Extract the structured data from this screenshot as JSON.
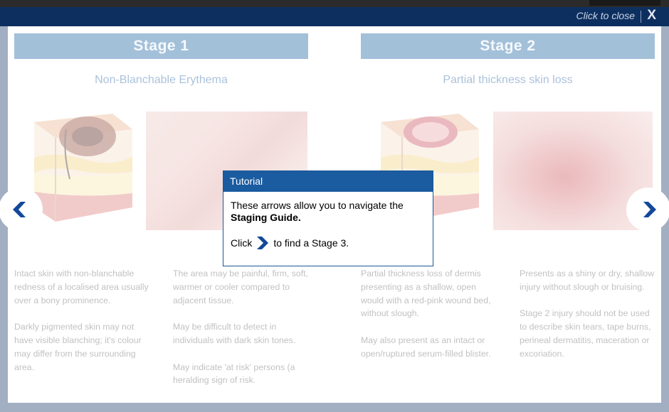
{
  "header": {
    "close_text": "Click to close",
    "close_icon_glyph": "X"
  },
  "stages": [
    {
      "title": "Stage 1",
      "subtitle": "Non-Blanchable Erythema",
      "col1": [
        "Intact skin with non-blanchable redness of a localised area usually over a bony prominence.",
        "Darkly pigmented skin may not have visible blanching; it's colour may differ from the surrounding area."
      ],
      "col2": [
        "The area may be painful, firm, soft, warmer or cooler compared to adjacent tissue.",
        "May be difficult to detect in individuals with dark skin tones.",
        "May indicate 'at risk' persons (a heralding sign of risk."
      ]
    },
    {
      "title": "Stage 2",
      "subtitle": "Partial thickness skin loss",
      "col1": [
        "Partial thickness loss of dermis presenting as a shallow, open would with a red-pink wound bed, without slough.",
        "May also present as an intact or open/ruptured serum-filled blister."
      ],
      "col2": [
        "Presents as a shiny or dry, shallow injury without slough or bruising.",
        "Stage 2 injury should not be used to describe skin tears, tape burns, perineal dermatitis, maceration or excoriation."
      ]
    }
  ],
  "nav": {
    "prev_icon": "chevron-left-icon",
    "next_icon": "chevron-right-icon"
  },
  "tutorial": {
    "title": "Tutorial",
    "line1_pre": "These arrows allow you to navigate the",
    "line1_bold": "Staging Guide.",
    "line2_pre": "Click",
    "line2_post": "to find a Stage 3."
  },
  "colors": {
    "frame_blue": "#0d2f60",
    "stage_bar_blue": "#0f5a9c",
    "subtitle_blue": "#1f5e9e",
    "tutorial_header_blue": "#1b5ba0",
    "arrow_blue": "#13489a"
  }
}
